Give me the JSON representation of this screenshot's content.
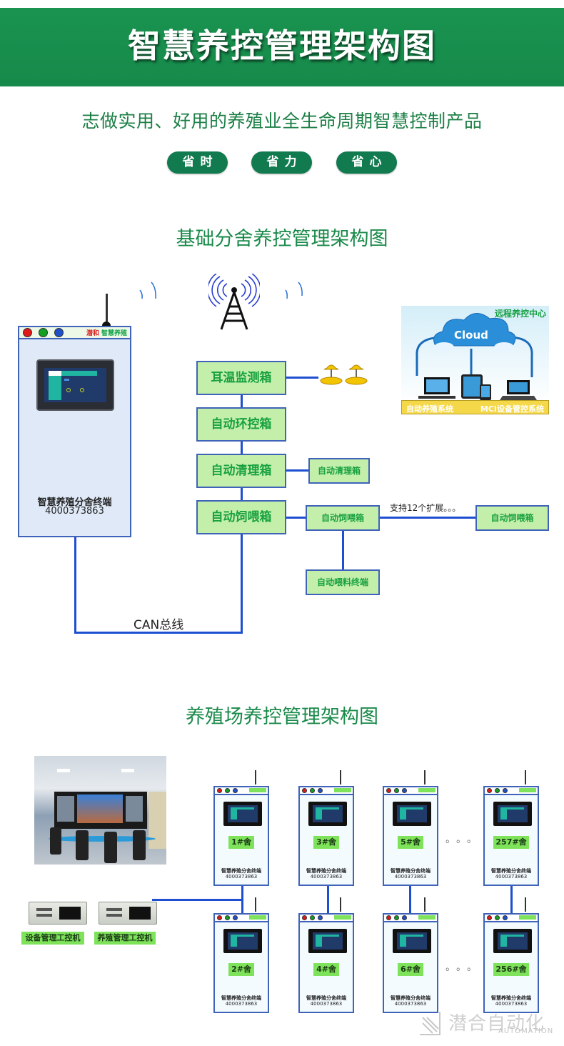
{
  "header": {
    "title": "智慧养控管理架构图",
    "slogan": "志做实用、好用的养殖业全生命周期智慧控制产品",
    "pills": [
      "省时",
      "省力",
      "省心"
    ]
  },
  "colors": {
    "banner_green": "#1a9350",
    "title_green": "#1a8a4a",
    "pill_green": "#117a4f",
    "box_fill": "#c4efab",
    "box_text": "#18a13f",
    "line_blue": "#1d4fd0",
    "tag_green": "#7ee25a",
    "led_red": "#e01818",
    "led_green": "#13a020",
    "led_blue": "#2050c8"
  },
  "basic": {
    "section_title": "基础分舍养控管理架构图",
    "terminal": {
      "brand": "潜和",
      "brand_sub": "智慧养殖",
      "label": "智慧养殖分舍终端",
      "number": "4000373863"
    },
    "boxes": [
      {
        "label": "耳温监测箱"
      },
      {
        "label": "自动环控箱"
      },
      {
        "label": "自动清理箱"
      },
      {
        "label": "自动饲喂箱"
      }
    ],
    "sub_boxes": {
      "cleaning": "自动清理箱",
      "feeder": "自动饲喂箱",
      "feeder_ext": "自动饲喂箱",
      "feed_terminal": "自动喂料终端"
    },
    "expansion_note": "支持12个扩展。。。",
    "bus_label": "CAN总线",
    "remote": {
      "title": "远程养控中心",
      "cloud_label": "Cloud",
      "system_left": "自动养殖系统",
      "system_right": "MCI设备管控系统"
    }
  },
  "farm": {
    "section_title": "养殖场养控管理架构图",
    "ipc": [
      "设备管理工控机",
      "养殖管理工控机"
    ],
    "terminal_label": "智慧养殖分舍终端",
    "terminal_number": "4000373863",
    "top_row": [
      "1#舍",
      "3#舍",
      "5#舍",
      "257#舍"
    ],
    "bottom_row": [
      "2#舍",
      "4#舍",
      "6#舍",
      "256#舍"
    ],
    "ellipsis": "。。。"
  },
  "watermark": {
    "cn": "潜合自动化",
    "en": "AUTOMATION"
  }
}
